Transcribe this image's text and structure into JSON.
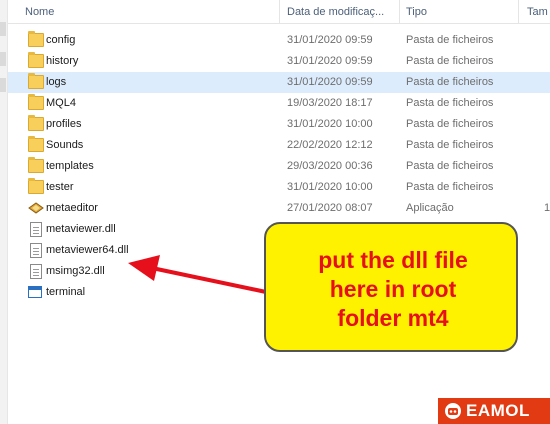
{
  "columns": {
    "name": "Nome",
    "date": "Data de modificaç...",
    "type": "Tipo",
    "size": "Tam"
  },
  "files": [
    {
      "name": "config",
      "date": "31/01/2020 09:59",
      "type": "Pasta de ficheiros",
      "size": "",
      "icon": "folder-icon"
    },
    {
      "name": "history",
      "date": "31/01/2020 09:59",
      "type": "Pasta de ficheiros",
      "size": "",
      "icon": "folder-icon"
    },
    {
      "name": "logs",
      "date": "31/01/2020 09:59",
      "type": "Pasta de ficheiros",
      "size": "",
      "icon": "folder-icon",
      "selected": true
    },
    {
      "name": "MQL4",
      "date": "19/03/2020 18:17",
      "type": "Pasta de ficheiros",
      "size": "",
      "icon": "folder-icon"
    },
    {
      "name": "profiles",
      "date": "31/01/2020 10:00",
      "type": "Pasta de ficheiros",
      "size": "",
      "icon": "folder-icon"
    },
    {
      "name": "Sounds",
      "date": "22/02/2020 12:12",
      "type": "Pasta de ficheiros",
      "size": "",
      "icon": "folder-icon"
    },
    {
      "name": "templates",
      "date": "29/03/2020 00:36",
      "type": "Pasta de ficheiros",
      "size": "",
      "icon": "folder-icon"
    },
    {
      "name": "tester",
      "date": "31/01/2020 10:00",
      "type": "Pasta de ficheiros",
      "size": "",
      "icon": "folder-icon"
    },
    {
      "name": "metaeditor",
      "date": "27/01/2020 08:07",
      "type": "Aplicação",
      "size": "1",
      "icon": "app-icon"
    },
    {
      "name": "metaviewer.dll",
      "date": "",
      "type": "",
      "size": "",
      "icon": "file-icon"
    },
    {
      "name": "metaviewer64.dll",
      "date": "",
      "type": "",
      "size": "",
      "icon": "file-icon"
    },
    {
      "name": "msimg32.dll",
      "date": "",
      "type": "",
      "size": "",
      "icon": "file-icon"
    },
    {
      "name": "terminal",
      "date": "",
      "type": "",
      "size": "",
      "icon": "terminal-icon"
    }
  ],
  "callout": {
    "text": "put the dll file\nhere in root\nfolder mt4"
  },
  "logo": {
    "text": "EAMOL"
  },
  "colors": {
    "callout_bg": "#fff200",
    "callout_text": "#e6101c",
    "arrow": "#e6101c",
    "selected_row": "#dcecfc",
    "logo_bg": "#e23a12"
  }
}
